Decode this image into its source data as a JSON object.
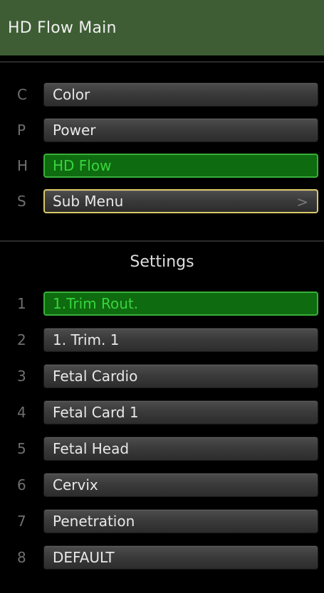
{
  "title": "HD Flow Main",
  "modes": [
    {
      "key": "C",
      "label": "Color"
    },
    {
      "key": "P",
      "label": "Power"
    },
    {
      "key": "H",
      "label": "HD Flow"
    },
    {
      "key": "S",
      "label": "Sub Menu",
      "chevron": ">"
    }
  ],
  "settings": {
    "title": "Settings",
    "items": [
      {
        "key": "1",
        "label": "1.Trim Rout."
      },
      {
        "key": "2",
        "label": "1. Trim. 1"
      },
      {
        "key": "3",
        "label": "Fetal Cardio"
      },
      {
        "key": "4",
        "label": "Fetal Card 1"
      },
      {
        "key": "5",
        "label": "Fetal Head"
      },
      {
        "key": "6",
        "label": "Cervix"
      },
      {
        "key": "7",
        "label": "Penetration"
      },
      {
        "key": "8",
        "label": "DEFAULT"
      }
    ]
  },
  "colors": {
    "title_bar": "#3e5d34",
    "active_fill": "#0f6b0f",
    "active_border": "#38b03a",
    "active_text": "#38d43e",
    "submenu_border": "#d9c867"
  }
}
